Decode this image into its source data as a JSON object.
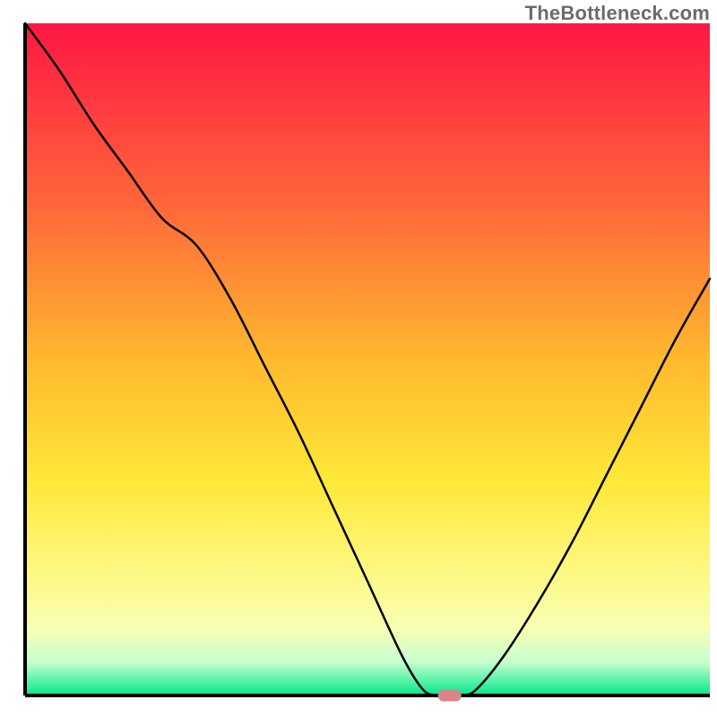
{
  "watermark": "TheBottleneck.com",
  "chart_data": {
    "type": "line",
    "title": "",
    "xlabel": "",
    "ylabel": "",
    "xlim": [
      0,
      100
    ],
    "ylim": [
      0,
      100
    ],
    "series": [
      {
        "name": "bottleneck-curve",
        "x": [
          0,
          5,
          10,
          15,
          20,
          25,
          30,
          35,
          40,
          45,
          50,
          55,
          58,
          60,
          62,
          64,
          66,
          70,
          75,
          80,
          85,
          90,
          95,
          100
        ],
        "y": [
          100,
          93,
          85,
          78,
          71,
          67,
          59,
          49,
          39,
          28,
          17,
          6,
          1,
          0,
          0,
          0,
          1,
          6,
          14,
          23,
          33,
          43,
          53,
          62
        ]
      }
    ],
    "marker": {
      "name": "optimal-point",
      "x": 62,
      "y": 0,
      "color": "#d9848b"
    },
    "background_gradient_stops": [
      {
        "offset": 0.0,
        "color": "#ff1744"
      },
      {
        "offset": 0.28,
        "color": "#ff6a3a"
      },
      {
        "offset": 0.5,
        "color": "#ffb92e"
      },
      {
        "offset": 0.68,
        "color": "#ffe838"
      },
      {
        "offset": 0.8,
        "color": "#fff67a"
      },
      {
        "offset": 0.9,
        "color": "#f7ffb3"
      },
      {
        "offset": 0.95,
        "color": "#c7ffd0"
      },
      {
        "offset": 1.0,
        "color": "#00e889"
      }
    ],
    "axis": {
      "color": "#000000",
      "width": 4
    },
    "curve_style": {
      "color": "#000000",
      "width": 2.5
    }
  }
}
